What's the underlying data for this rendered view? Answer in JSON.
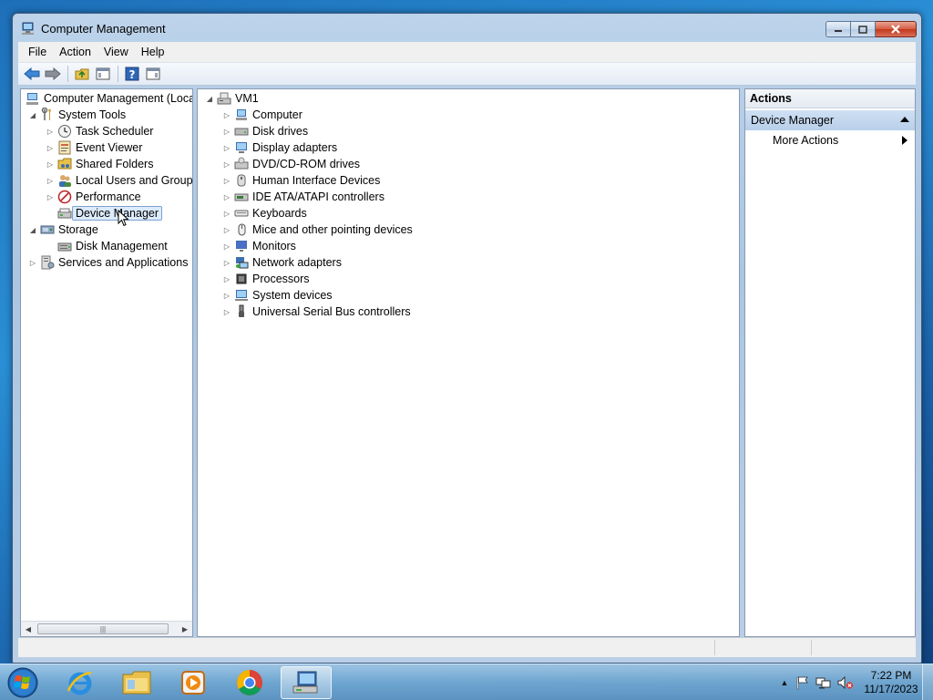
{
  "window": {
    "title": "Computer Management"
  },
  "menu": [
    "File",
    "Action",
    "View",
    "Help"
  ],
  "toolbar": {
    "buttons": [
      "back-icon",
      "forward-icon",
      "up-folder-icon",
      "show-hide-tree-icon",
      "help-icon",
      "show-hide-action-pane-icon"
    ]
  },
  "tree": {
    "root": "Computer Management (Local",
    "system_tools": "System Tools",
    "task_scheduler": "Task Scheduler",
    "event_viewer": "Event Viewer",
    "shared_folders": "Shared Folders",
    "local_users": "Local Users and Groups",
    "performance": "Performance",
    "device_manager": "Device Manager",
    "storage": "Storage",
    "disk_management": "Disk Management",
    "services": "Services and Applications"
  },
  "devices": {
    "root": "VM1",
    "categories": [
      "Computer",
      "Disk drives",
      "Display adapters",
      "DVD/CD-ROM drives",
      "Human Interface Devices",
      "IDE ATA/ATAPI controllers",
      "Keyboards",
      "Mice and other pointing devices",
      "Monitors",
      "Network adapters",
      "Processors",
      "System devices",
      "Universal Serial Bus controllers"
    ]
  },
  "actions": {
    "header": "Actions",
    "section": "Device Manager",
    "more": "More Actions"
  },
  "taskbar": {
    "apps": [
      "internet-explorer-icon",
      "windows-explorer-icon",
      "media-player-icon",
      "chrome-icon",
      "computer-management-icon"
    ],
    "time": "7:22 PM",
    "date": "11/17/2023"
  }
}
